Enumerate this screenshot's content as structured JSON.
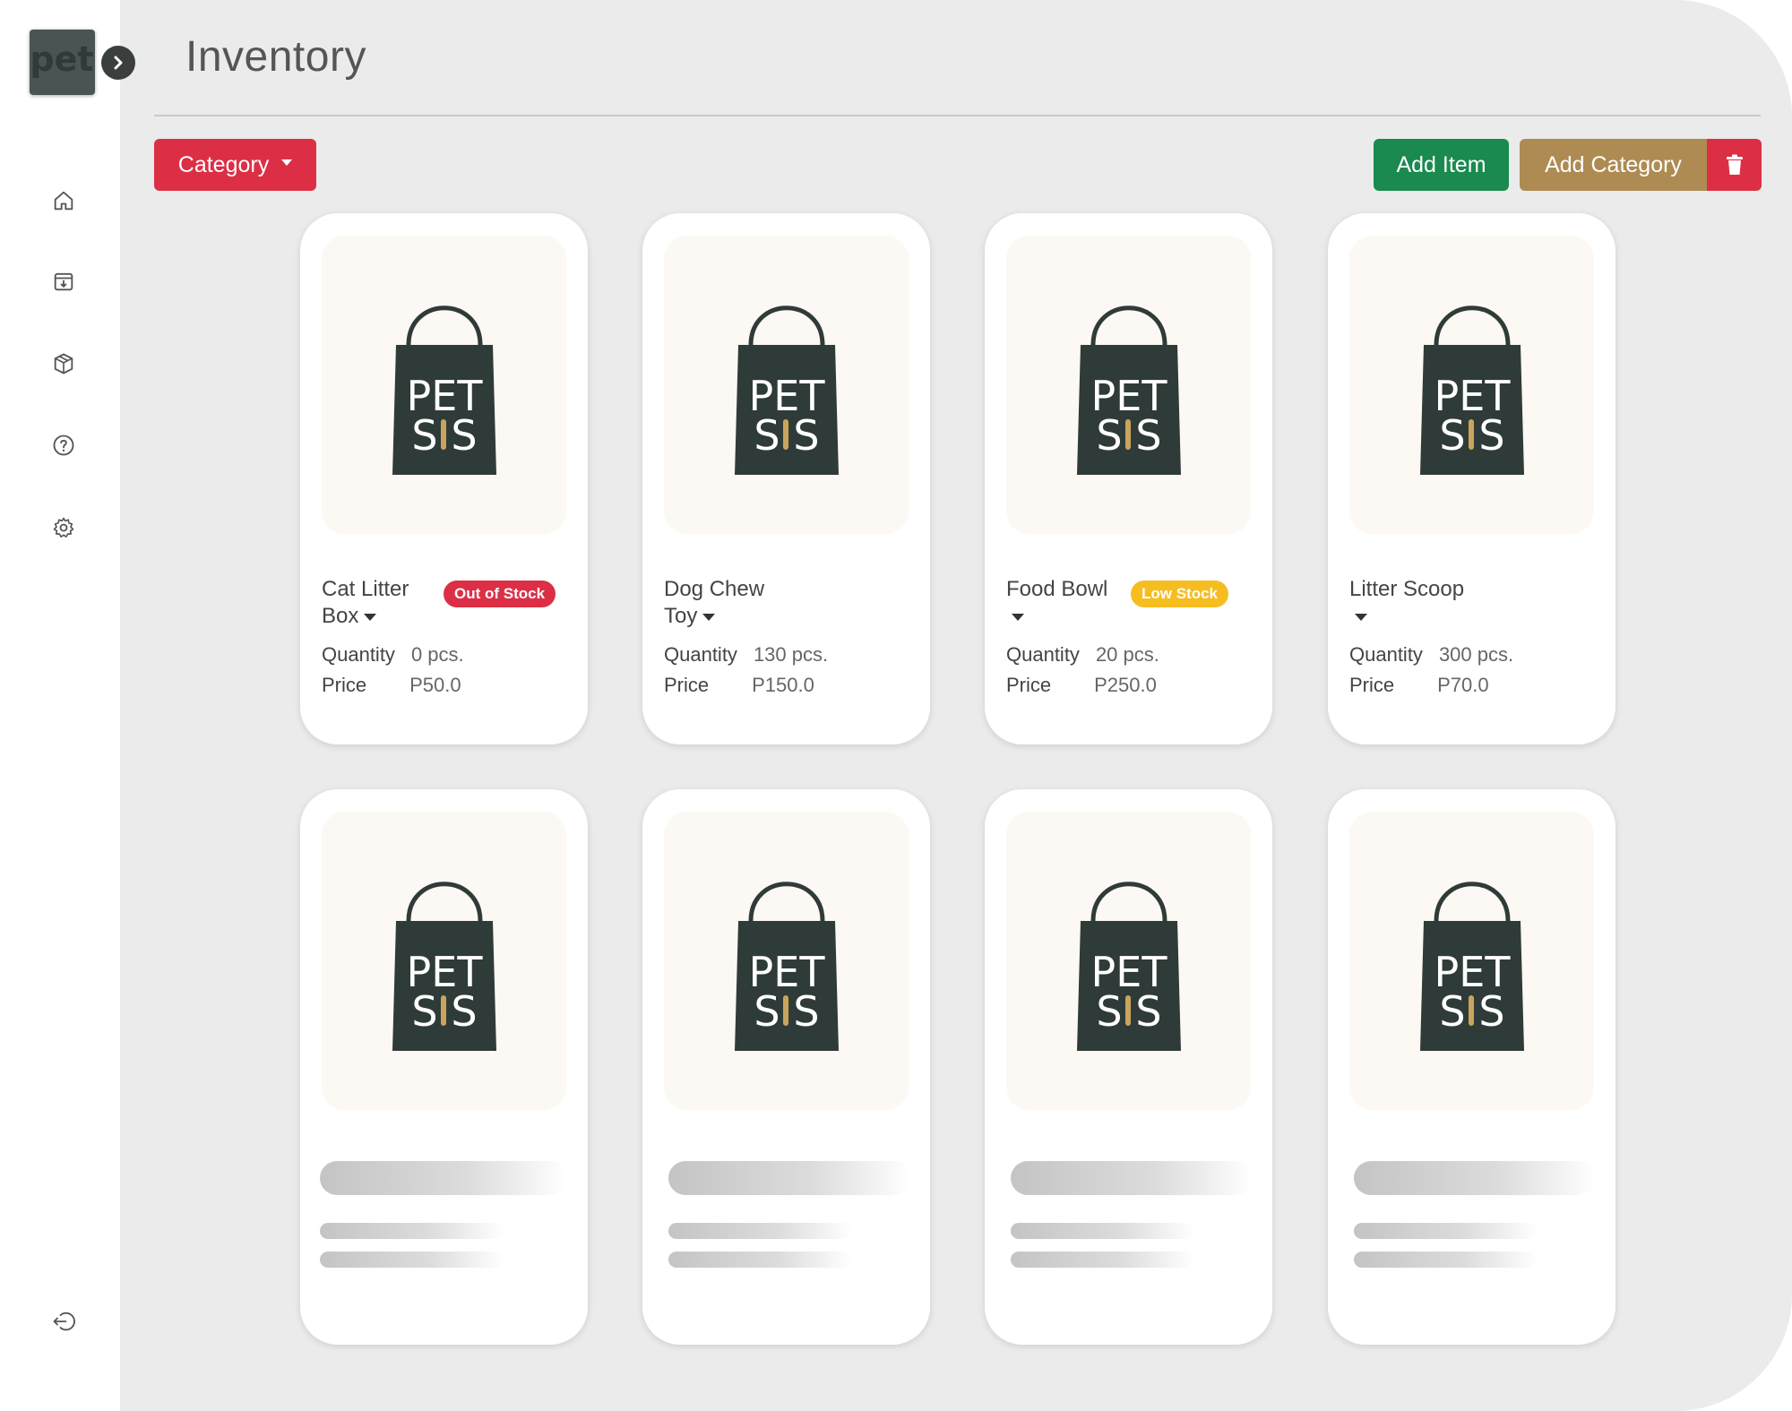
{
  "page": {
    "title": "Inventory"
  },
  "brand": {
    "logo_text": "pet"
  },
  "toolbar": {
    "category_label": "Category",
    "add_item_label": "Add Item",
    "add_category_label": "Add Category"
  },
  "sidebar": {
    "items": [
      {
        "name": "home",
        "icon": "home-icon"
      },
      {
        "name": "archive",
        "icon": "archive-icon"
      },
      {
        "name": "products",
        "icon": "box-icon"
      },
      {
        "name": "help",
        "icon": "help-icon"
      },
      {
        "name": "settings",
        "icon": "gear-icon"
      },
      {
        "name": "logout",
        "icon": "logout-icon"
      }
    ]
  },
  "product_image": {
    "line1": "PET",
    "line2a": "S",
    "line2b": "S"
  },
  "labels": {
    "quantity": "Quantity",
    "price": "Price"
  },
  "items": [
    {
      "name": "Cat Litter Box",
      "badge": "Out of Stock",
      "quantity": "0 pcs.",
      "price": "P50.0"
    },
    {
      "name": "Dog Chew Toy",
      "badge": "",
      "quantity": "130 pcs.",
      "price": "P150.0"
    },
    {
      "name": "Food Bowl",
      "badge": "Low Stock",
      "quantity": "20 pcs.",
      "price": "P250.0"
    },
    {
      "name": "Litter Scoop",
      "badge": "",
      "quantity": "300 pcs.",
      "price": "P70.0"
    }
  ],
  "colors": {
    "category_button": "#dc2f45",
    "add_item_button": "#1a8a50",
    "add_category_button": "#ad8b52",
    "delete_button": "#dc2f45",
    "out_of_stock": "#dc2f45",
    "low_stock": "#f5bd1f",
    "bag": "#2f3b38",
    "bone": "#c9a45c"
  }
}
